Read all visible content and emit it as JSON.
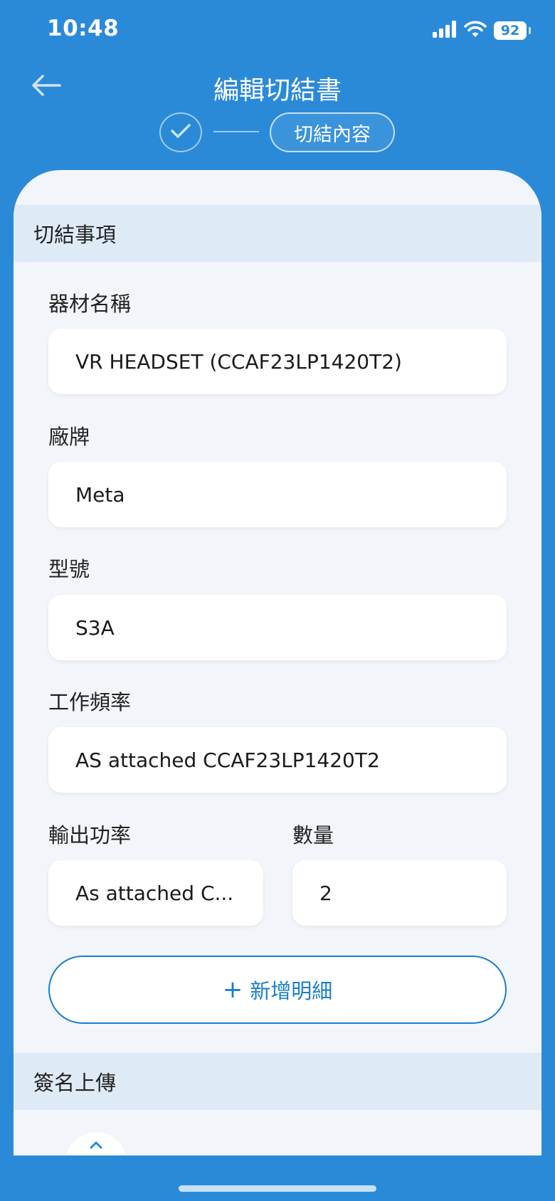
{
  "status": {
    "time": "10:48",
    "battery": "92",
    "icons": [
      "signal-icon",
      "wifi-icon",
      "battery-icon"
    ]
  },
  "nav": {
    "title": "編輯切結書",
    "back_icon": "arrow-left-icon"
  },
  "stepper": {
    "done_icon": "check-icon",
    "current_label": "切結內容"
  },
  "sections": {
    "items_header": "切結事項",
    "signature_header": "簽名上傳"
  },
  "fields": {
    "equipment_name": {
      "label": "器材名稱",
      "value": "VR HEADSET (CCAF23LP1420T2)"
    },
    "brand": {
      "label": "廠牌",
      "value": "Meta"
    },
    "model": {
      "label": "型號",
      "value": "S3A"
    },
    "frequency": {
      "label": "工作頻率",
      "value": "AS attached CCAF23LP1420T2"
    },
    "output_power": {
      "label": "輸出功率",
      "value": "As attached C..."
    },
    "quantity": {
      "label": "數量",
      "value": "2"
    }
  },
  "add_detail": {
    "icon": "+",
    "label": "新增明細"
  },
  "colors": {
    "primary": "#2b8ad8",
    "accent": "#1b7ecb",
    "sheet_bg": "#f2f5fa",
    "section_bg": "#dfeaf7"
  }
}
